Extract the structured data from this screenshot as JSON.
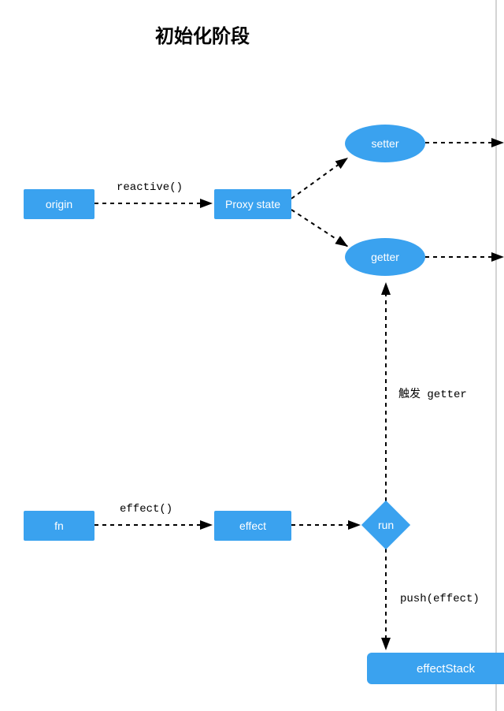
{
  "title": "初始化阶段",
  "nodes": {
    "origin": "origin",
    "proxy_state": "Proxy state",
    "setter": "setter",
    "getter": "getter",
    "fn": "fn",
    "effect": "effect",
    "run": "run",
    "effect_stack": "effectStack"
  },
  "edges": {
    "reactive": "reactive()",
    "effect_call": "effect()",
    "trigger_getter": "触发 getter",
    "push_effect": "push(effect)"
  },
  "colors": {
    "node_fill": "#3aa2ef",
    "node_text": "#ffffff",
    "edge": "#000000"
  }
}
